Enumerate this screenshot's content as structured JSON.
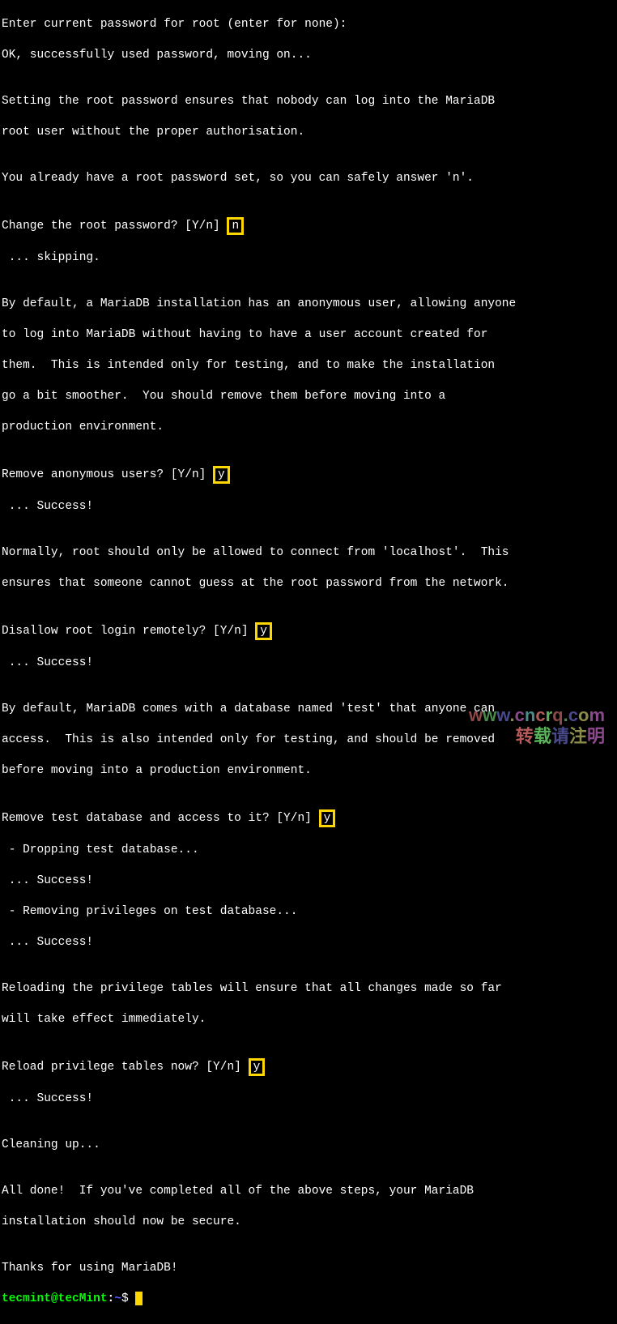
{
  "lines": {
    "l1": "Enter current password for root (enter for none):",
    "l2": "OK, successfully used password, moving on...",
    "l3": "",
    "l4": "Setting the root password ensures that nobody can log into the MariaDB",
    "l5": "root user without the proper authorisation.",
    "l6": "",
    "l7": "You already have a root password set, so you can safely answer 'n'.",
    "l8": "",
    "q1_prompt": "Change the root password? [Y/n] ",
    "q1_answer": "n",
    "l9": " ... skipping.",
    "l10": "",
    "l11": "By default, a MariaDB installation has an anonymous user, allowing anyone",
    "l12": "to log into MariaDB without having to have a user account created for",
    "l13": "them.  This is intended only for testing, and to make the installation",
    "l14": "go a bit smoother.  You should remove them before moving into a",
    "l15": "production environment.",
    "l16": "",
    "q2_prompt": "Remove anonymous users? [Y/n] ",
    "q2_answer": "y",
    "l17": " ... Success!",
    "l18": "",
    "l19": "Normally, root should only be allowed to connect from 'localhost'.  This",
    "l20": "ensures that someone cannot guess at the root password from the network.",
    "l21": "",
    "q3_prompt": "Disallow root login remotely? [Y/n] ",
    "q3_answer": "y",
    "l22": " ... Success!",
    "l23": "",
    "l24": "By default, MariaDB comes with a database named 'test' that anyone can",
    "l25": "access.  This is also intended only for testing, and should be removed",
    "l26": "before moving into a production environment.",
    "l27": "",
    "q4_prompt": "Remove test database and access to it? [Y/n] ",
    "q4_answer": "y",
    "l28": " - Dropping test database...",
    "l29": " ... Success!",
    "l30": " - Removing privileges on test database...",
    "l31": " ... Success!",
    "l32": "",
    "l33": "Reloading the privilege tables will ensure that all changes made so far",
    "l34": "will take effect immediately.",
    "l35": "",
    "q5_prompt": "Reload privilege tables now? [Y/n] ",
    "q5_answer": "y",
    "l36": " ... Success!",
    "l37": "",
    "l38": "Cleaning up...",
    "l39": "",
    "l40": "All done!  If you've completed all of the above steps, your MariaDB",
    "l41": "installation should now be secure.",
    "l42": "",
    "l43": "Thanks for using MariaDB!"
  },
  "prompt": {
    "user": "tecmint",
    "at": "@",
    "host": "tecMint",
    "colon": ":",
    "path": "~",
    "dollar": "$ "
  },
  "watermark": {
    "url_w1": "w",
    "url_w2": "w",
    "url_w3": "w",
    "url_dot1": ".",
    "url_c": "c",
    "url_n": "n",
    "url_c2": "c",
    "url_r": "r",
    "url_q": "q",
    "url_dot2": ".",
    "url_c3": "c",
    "url_o": "o",
    "url_m": "m",
    "zh1": "转",
    "zh2": "载",
    "zh3": "请",
    "zh4": "注",
    "zh5": "明"
  }
}
